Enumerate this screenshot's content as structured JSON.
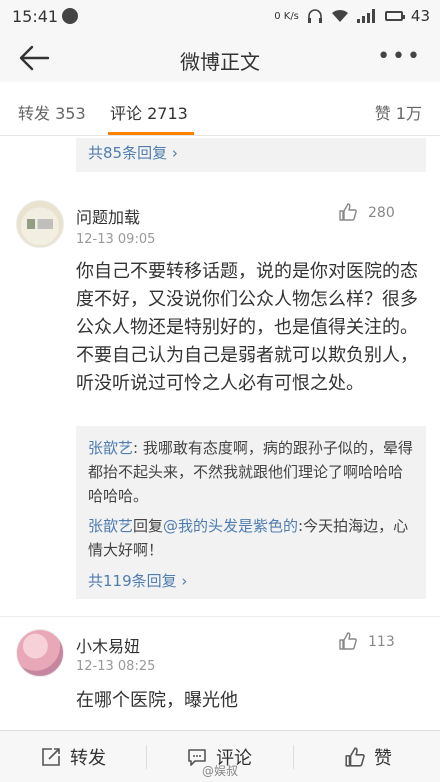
{
  "status": {
    "time": "15:41",
    "net": "0 K/s",
    "battery": "43"
  },
  "nav": {
    "title": "微博正文"
  },
  "tabs": {
    "repost": "转发 353",
    "comment": "评论 2713",
    "like": "赞 1万"
  },
  "prev_replies_more": "共85条回复 ›",
  "comments": [
    {
      "user": "问题加载",
      "time": "12-13 09:05",
      "likes": "280",
      "text": "你自己不要转移话题，说的是你对医院的态度不好，又没说你们公众人物怎么样？很多公众人物还是特别好的，也是值得关注的。不要自己认为自己是弱者就可以欺负别人，听没听说过可怜之人必有可恨之处。",
      "replies": [
        {
          "name": "张歆艺",
          "sep": ": ",
          "text": "我哪敢有态度啊，病的跟孙子似的，晕得都抬不起头来，不然我就跟他们理论了啊哈哈哈哈哈哈。"
        },
        {
          "name": "张歆艺",
          "verb": "回复",
          "mention": "@我的头发是紫色的",
          "sep": ":",
          "text": "今天拍海边，心情大好啊！"
        }
      ],
      "replies_more": "共119条回复 ›"
    },
    {
      "user": "小木易妞",
      "time": "12-13 08:25",
      "likes": "113",
      "text": "在哪个医院，曝光他"
    }
  ],
  "bottom": {
    "repost": "转发",
    "comment": "评论",
    "like": "赞"
  },
  "watermark": "@娱叔",
  "colors": {
    "accent": "#ff8200",
    "link": "#507daf"
  }
}
